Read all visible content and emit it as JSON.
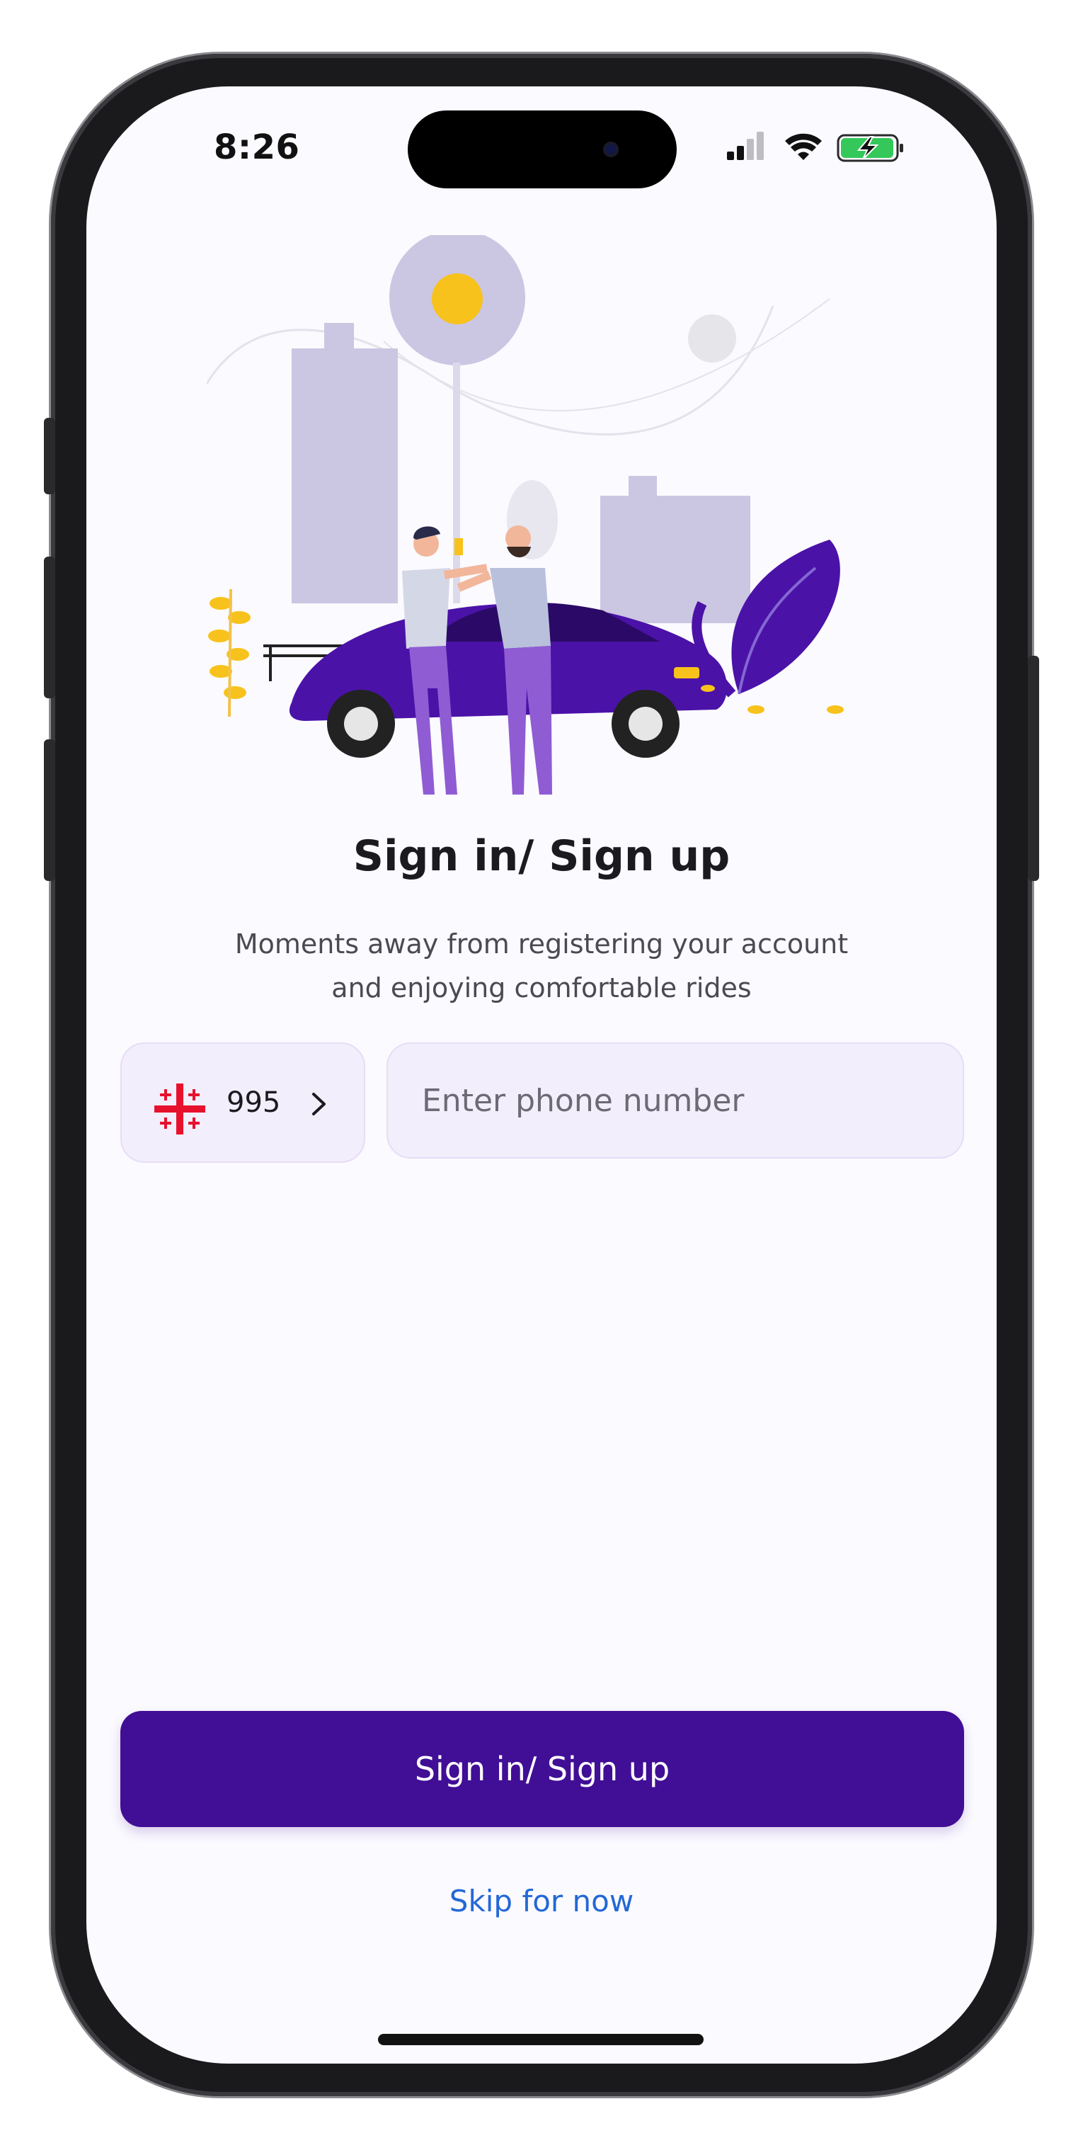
{
  "status_bar": {
    "time": "8:26"
  },
  "signin": {
    "title": "Sign in/ Sign up",
    "subtitle": "Moments away from registering your account and enjoying comfortable rides",
    "country_code": "995",
    "phone_placeholder": "Enter phone number",
    "primary_button": "Sign in/ Sign up",
    "skip_link": "Skip for now"
  },
  "icons": {
    "flag": "georgia-flag-icon",
    "chevron": "chevron-right-icon",
    "signal": "cellular-signal-icon",
    "wifi": "wifi-icon",
    "battery": "battery-charging-icon"
  },
  "colors": {
    "accent": "#410E96",
    "link": "#2368D6",
    "field_background": "#F3EEFC",
    "screen_background": "#FBFAFF",
    "flag_red": "#E8112D",
    "battery_green": "#34C759"
  }
}
